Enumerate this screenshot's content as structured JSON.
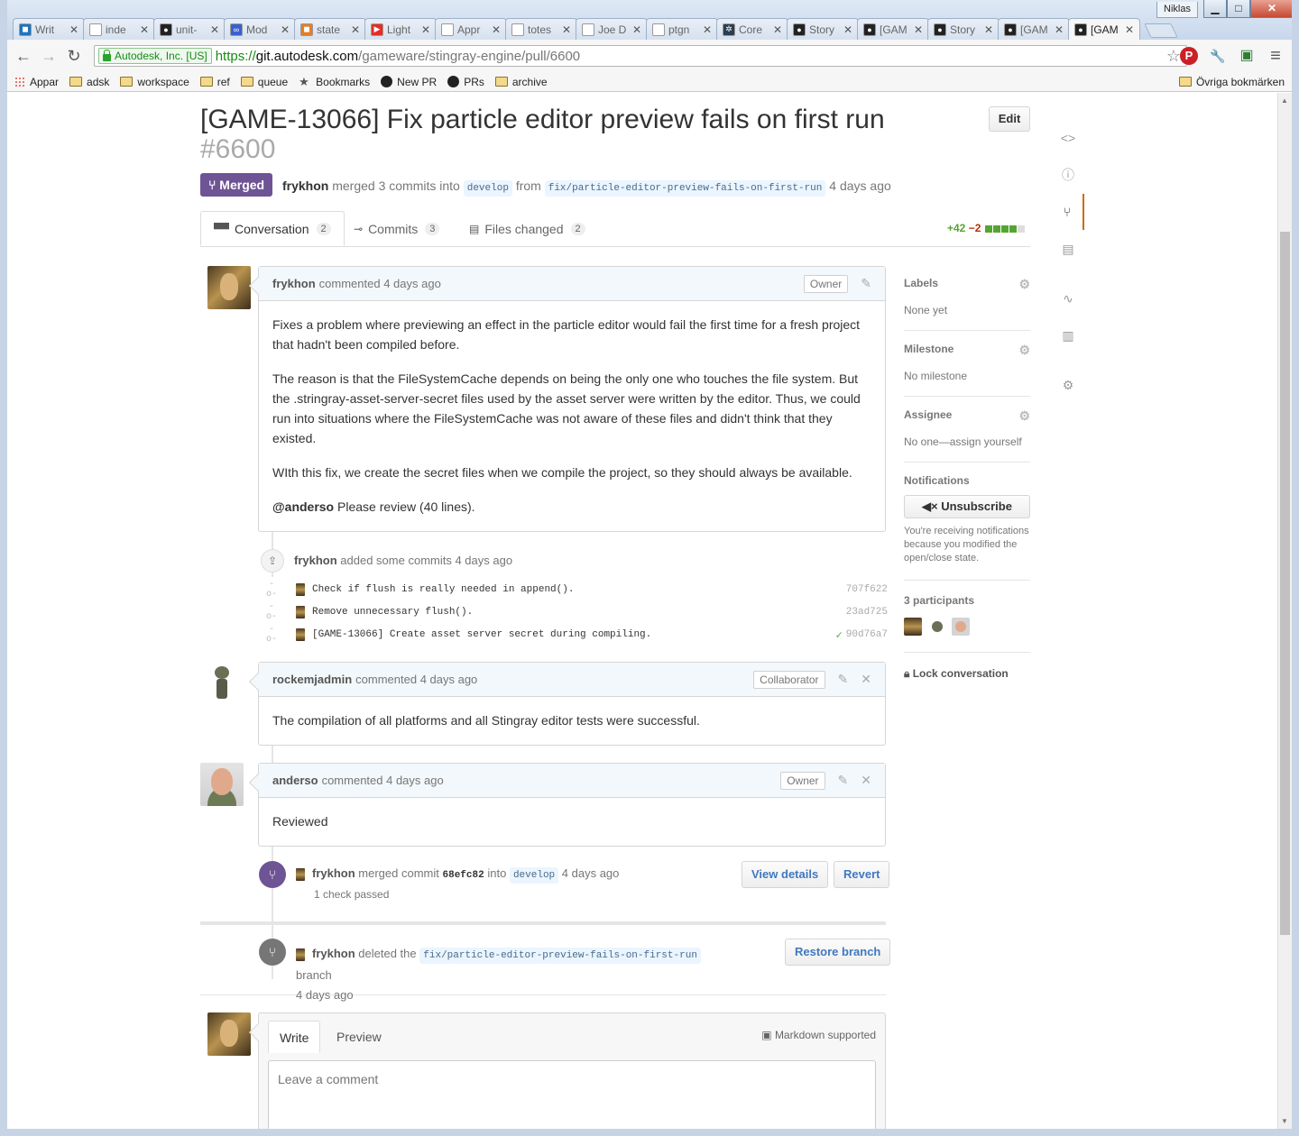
{
  "window": {
    "user": "Niklas",
    "min": "▁",
    "max": "□",
    "close": "✕"
  },
  "tabs": [
    {
      "title": "Writ",
      "color": "#1e73be",
      "glyph": "◼"
    },
    {
      "title": "inde",
      "color": "#ffffff",
      "glyph": "▯"
    },
    {
      "title": "unit-",
      "color": "#222222",
      "glyph": "●"
    },
    {
      "title": "Mod",
      "color": "#3a5fcd",
      "glyph": "∞"
    },
    {
      "title": "state",
      "color": "#e67e22",
      "glyph": "◼"
    },
    {
      "title": "Light",
      "color": "#e52d27",
      "glyph": "▶"
    },
    {
      "title": "Appr",
      "color": "#ffffff",
      "glyph": "▯"
    },
    {
      "title": "totes",
      "color": "#ffffff",
      "glyph": "▯"
    },
    {
      "title": "Joe D",
      "color": "#ffffff",
      "glyph": "▯"
    },
    {
      "title": "ptgn",
      "color": "#ffffff",
      "glyph": "▯"
    },
    {
      "title": "Core",
      "color": "#2c3e50",
      "glyph": "✲"
    },
    {
      "title": "Story",
      "color": "#222222",
      "glyph": "●"
    },
    {
      "title": "[GAM",
      "color": "#222222",
      "glyph": "●"
    },
    {
      "title": "Story",
      "color": "#222222",
      "glyph": "●"
    },
    {
      "title": "[GAM",
      "color": "#222222",
      "glyph": "●"
    },
    {
      "title": "[GAM",
      "color": "#222222",
      "glyph": "●",
      "active": true
    }
  ],
  "toolbar": {
    "back": "←",
    "forward": "→",
    "reload": "↻",
    "ev_label": "Autodesk, Inc. [US]",
    "url_scheme": "https://",
    "url_host": "git.autodesk.com",
    "url_path": "/gameware/stingray-engine/pull/6600",
    "star": "☆",
    "ext_pinterest": "P",
    "ext_wrench": "🔧",
    "ext_other": "▣",
    "menu": "≡"
  },
  "bookmarks": {
    "items": [
      "Appar",
      "adsk",
      "workspace",
      "ref",
      "queue",
      "Bookmarks",
      "New PR",
      "PRs",
      "archive"
    ],
    "other": "Övriga bokmärken"
  },
  "pr": {
    "title": "[GAME-13066] Fix particle editor preview fails on first run",
    "number": "#6600",
    "edit_label": "Edit",
    "state": "Merged",
    "author": "frykhon",
    "merged_text": "merged 3 commits into",
    "base_branch": "develop",
    "from_text": "from",
    "head_branch": "fix/particle-editor-preview-fails-on-first-run",
    "when": "4 days ago"
  },
  "pr_tabs": [
    {
      "label": "Conversation",
      "count": "2",
      "icon": "💬"
    },
    {
      "label": "Commits",
      "count": "3",
      "icon": "⊸"
    },
    {
      "label": "Files changed",
      "count": "2",
      "icon": "▤"
    }
  ],
  "diffstat": {
    "additions": "+42",
    "deletions": "−2"
  },
  "comments": {
    "first": {
      "author": "frykhon",
      "action": "commented 4 days ago",
      "role": "Owner",
      "paragraphs": [
        "Fixes a problem where previewing an effect in the particle editor would fail the first time for a fresh project that hadn't been compiled before.",
        "The reason is that the FileSystemCache depends on being the only one who touches the file system. But the .stringray-asset-server-secret files used by the asset server were written by the editor. Thus, we could run into situations where the FileSystemCache was not aware of these files and didn't think that they existed.",
        "WIth this fix, we create the secret files when we compile the project, so they should always be available."
      ],
      "mention": "@anderso",
      "mention_rest": "Please review (40 lines)."
    },
    "second": {
      "author": "rockemjadmin",
      "action": "commented 4 days ago",
      "role": "Collaborator",
      "body": "The compilation of all platforms and all Stingray editor tests were successful."
    },
    "third": {
      "author": "anderso",
      "action": "commented 4 days ago",
      "role": "Owner",
      "body": "Reviewed"
    }
  },
  "commits_event": {
    "author": "frykhon",
    "text": "added some commits 4 days ago",
    "items": [
      {
        "msg": "Check if flush is really needed in append().",
        "sha": "707f622",
        "check": ""
      },
      {
        "msg": "Remove unnecessary flush().",
        "sha": "23ad725",
        "check": ""
      },
      {
        "msg": "[GAME-13066] Create asset server secret during compiling.",
        "sha": "90d76a7",
        "check": "✓"
      }
    ]
  },
  "merge_event": {
    "author": "frykhon",
    "text": "merged commit",
    "sha": "68efc82",
    "into": "into",
    "branch": "develop",
    "when": "4 days ago",
    "checks": "1 check passed",
    "view_details": "View details",
    "revert": "Revert"
  },
  "delete_event": {
    "author": "frykhon",
    "text": "deleted the",
    "branch": "fix/particle-editor-preview-fails-on-first-run",
    "suffix": "branch",
    "when": "4 days ago",
    "restore": "Restore branch"
  },
  "sidebar": {
    "labels_title": "Labels",
    "labels_value": "None yet",
    "milestone_title": "Milestone",
    "milestone_value": "No milestone",
    "assignee_title": "Assignee",
    "assignee_value": "No one—assign yourself",
    "notifications_title": "Notifications",
    "unsubscribe": "Unsubscribe",
    "notif_reason": "You're receiving notifications because you modified the open/close state.",
    "participants_title": "3 participants",
    "lock": "Lock conversation"
  },
  "composer": {
    "write": "Write",
    "preview": "Preview",
    "markdown": "Markdown supported",
    "placeholder": "Leave a comment"
  },
  "colors": {
    "merged": "#6e5494",
    "link": "#4078c0",
    "add": "#55a532",
    "del": "#bd2c00"
  }
}
